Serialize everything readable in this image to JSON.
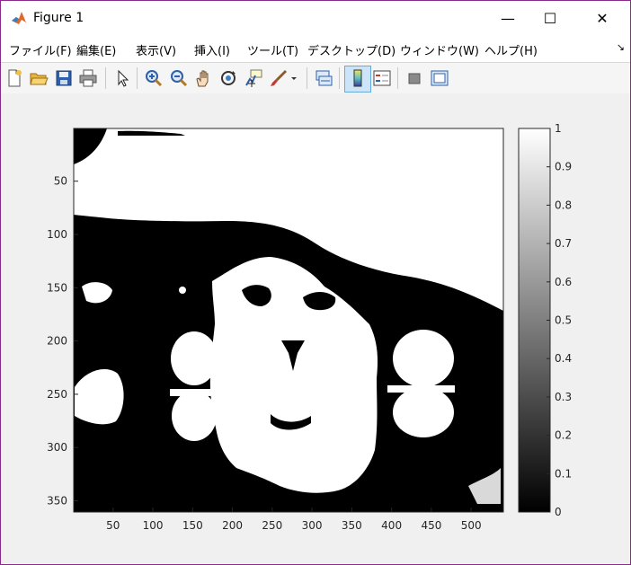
{
  "window": {
    "title": "Figure 1",
    "minimize": "—",
    "maximize": "☐",
    "close": "✕"
  },
  "menubar": {
    "items": [
      {
        "label": "ファイル(F)"
      },
      {
        "label": "編集(E)"
      },
      {
        "label": "表示(V)"
      },
      {
        "label": "挿入(I)"
      },
      {
        "label": "ツール(T)"
      },
      {
        "label": "デスクトップ(D)"
      },
      {
        "label": "ウィンドウ(W)"
      },
      {
        "label": "ヘルプ(H)"
      }
    ],
    "overflow_icon": "arrow-icon"
  },
  "toolbar": {
    "buttons": [
      "new-figure-icon",
      "open-file-icon",
      "save-icon",
      "print-icon",
      "pointer-icon",
      "zoom-in-icon",
      "zoom-out-icon",
      "pan-hand-icon",
      "rotate-3d-icon",
      "data-cursor-icon",
      "brush-icon",
      "brush-dropdown-icon",
      "link-plot-icon",
      "colorbar-icon",
      "legend-icon",
      "hide-plot-tools-icon",
      "show-plot-tools-icon"
    ],
    "active": "colorbar-icon"
  },
  "plot": {
    "x_ticks": [
      "50",
      "100",
      "150",
      "200",
      "250",
      "300",
      "350",
      "400",
      "450",
      "500"
    ],
    "y_ticks": [
      "50",
      "100",
      "150",
      "200",
      "250",
      "300",
      "350"
    ],
    "colorbar_ticks": [
      "0",
      "0.1",
      "0.2",
      "0.3",
      "0.4",
      "0.5",
      "0.6",
      "0.7",
      "0.8",
      "0.9",
      "1"
    ],
    "image_description_type": "binary (black/white) thresholded image of a face",
    "colormap": "gray"
  },
  "chart_data": {
    "type": "heatmap",
    "image_size": [
      540,
      360
    ],
    "xlim": [
      1,
      540
    ],
    "ylim": [
      1,
      360
    ],
    "x_ticks": [
      50,
      100,
      150,
      200,
      250,
      300,
      350,
      400,
      450,
      500
    ],
    "y_ticks": [
      50,
      100,
      150,
      200,
      250,
      300,
      350
    ],
    "colorbar": {
      "range": [
        0,
        1
      ],
      "ticks": [
        0,
        0.1,
        0.2,
        0.3,
        0.4,
        0.5,
        0.6,
        0.7,
        0.8,
        0.9,
        1
      ],
      "colormap": "gray"
    },
    "values_present": [
      0,
      1
    ]
  }
}
